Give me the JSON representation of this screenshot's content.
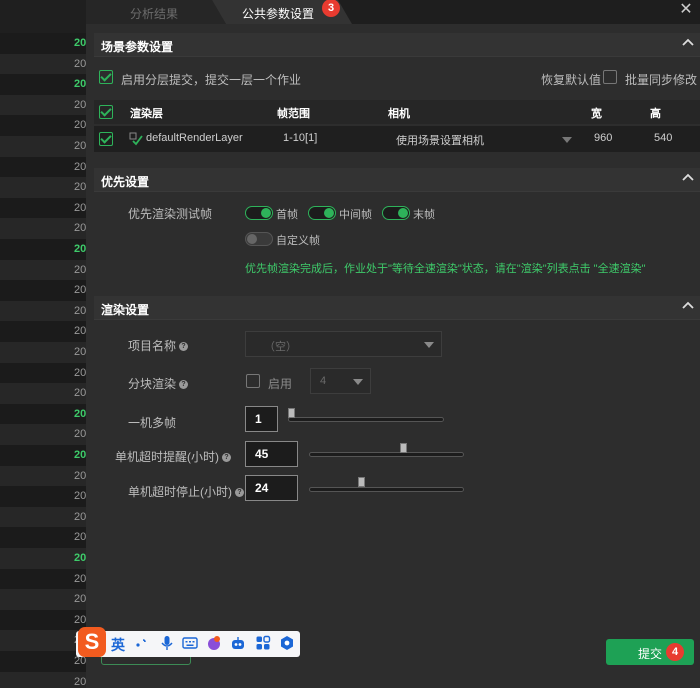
{
  "left_strip": {
    "rows": [
      {
        "value": "20",
        "highlight": true
      },
      {
        "value": "20",
        "highlight": false
      },
      {
        "value": "20",
        "highlight": true
      },
      {
        "value": "20",
        "highlight": false
      },
      {
        "value": "20",
        "highlight": false
      },
      {
        "value": "20",
        "highlight": false
      },
      {
        "value": "20",
        "highlight": false
      },
      {
        "value": "20",
        "highlight": false
      },
      {
        "value": "20",
        "highlight": false
      },
      {
        "value": "20",
        "highlight": false
      },
      {
        "value": "20",
        "highlight": true
      },
      {
        "value": "20",
        "highlight": false
      },
      {
        "value": "20",
        "highlight": false
      },
      {
        "value": "20",
        "highlight": false
      },
      {
        "value": "20",
        "highlight": false
      },
      {
        "value": "20",
        "highlight": false
      },
      {
        "value": "20",
        "highlight": false
      },
      {
        "value": "20",
        "highlight": false
      },
      {
        "value": "20",
        "highlight": true
      },
      {
        "value": "20",
        "highlight": false
      },
      {
        "value": "20",
        "highlight": true
      },
      {
        "value": "20",
        "highlight": false
      },
      {
        "value": "20",
        "highlight": false
      },
      {
        "value": "20",
        "highlight": false
      },
      {
        "value": "20",
        "highlight": false
      },
      {
        "value": "20",
        "highlight": true
      },
      {
        "value": "20",
        "highlight": false
      },
      {
        "value": "20",
        "highlight": false
      },
      {
        "value": "20",
        "highlight": false
      },
      {
        "value": "20",
        "highlight": false
      },
      {
        "value": "20",
        "highlight": false
      },
      {
        "value": "20",
        "highlight": false
      }
    ]
  },
  "tabs": {
    "inactive": "分析结果",
    "active": "公共参数设置",
    "active_badge": "3"
  },
  "scene_section": {
    "title": "场景参数设置",
    "layered_submit_label": "启用分层提交，提交一层一个作业",
    "restore_default": "恢复默认值",
    "batch_sync_label": "批量同步修改",
    "table": {
      "headers": [
        "渲染层",
        "帧范围",
        "相机",
        "宽",
        "高"
      ],
      "row": {
        "layer": "defaultRenderLayer",
        "frame_range": "1-10[1]",
        "camera": "使用场景设置相机",
        "width": "960",
        "height": "540"
      }
    }
  },
  "priority_section": {
    "title": "优先设置",
    "test_frame_label": "优先渲染测试帧",
    "toggles": [
      {
        "label": "首帧",
        "on": true
      },
      {
        "label": "中间帧",
        "on": true
      },
      {
        "label": "末帧",
        "on": true
      },
      {
        "label": "自定义帧",
        "on": false
      }
    ],
    "notice": "优先帧渲染完成后，作业处于\"等待全速渲染\"状态，请在\"渲染\"列表点击 \"全速渲染\""
  },
  "render_section": {
    "title": "渲染设置",
    "project_name_label": "项目名称",
    "project_name_value": "（空）",
    "tile_render_label": "分块渲染",
    "tile_enable_label": "启用",
    "tile_count": "4",
    "multi_frame_label": "一机多帧",
    "multi_frame_value": "1",
    "multi_frame_level": 0,
    "timeout_remind_label": "单机超时提醒(小时)",
    "timeout_remind_value": "45",
    "timeout_remind_level": 0.62,
    "timeout_stop_label": "单机超时停止(小时)",
    "timeout_stop_value": "24",
    "timeout_stop_level": 0.33
  },
  "footer": {
    "submit_label": "提交",
    "submit_badge": "4"
  },
  "ime": {
    "logo": "S",
    "lang": "英"
  },
  "colors": {
    "accent_green": "#2eb35a",
    "badge_red": "#e83b30",
    "notice_green": "#3ecb6a"
  }
}
